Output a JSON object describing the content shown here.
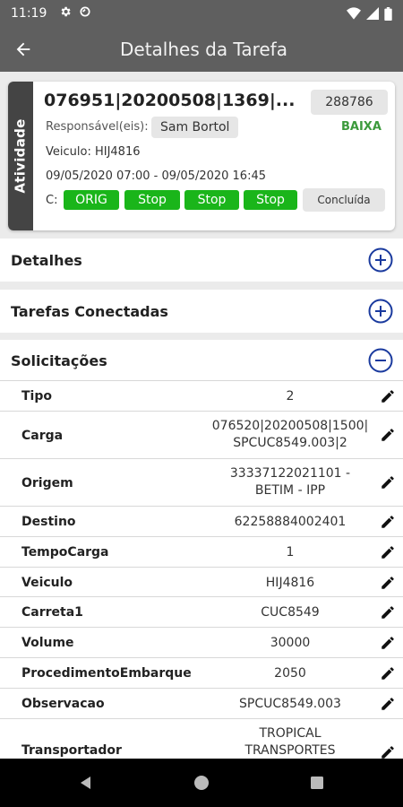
{
  "status_bar": {
    "time": "11:19",
    "icons": [
      "gear-icon",
      "sync-icon",
      "wifi-icon",
      "signal-icon",
      "battery-icon"
    ]
  },
  "app_bar": {
    "title": "Detalhes da Tarefa",
    "back_icon": "arrow-left-icon"
  },
  "card": {
    "side_label": "Atividade",
    "code": "076951|20200508|1369|...",
    "number": "288786",
    "responsible_label": "Responsável(eis):",
    "responsible_name": "Sam Bortol",
    "priority": "BAIXA",
    "vehicle": "Veiculo: HIJ4816",
    "period": "09/05/2020 07:00 - 09/05/2020 16:45",
    "c_label": "C:",
    "steps": [
      "ORIG",
      "Stop",
      "Stop",
      "Stop"
    ],
    "status_button": "Concluída"
  },
  "sections": {
    "detalhes": "Detalhes",
    "tarefas_conectadas": "Tarefas Conectadas",
    "solicitacoes": "Solicitações"
  },
  "rows": [
    {
      "key": "Tipo",
      "value": "2"
    },
    {
      "key": "Carga",
      "value": "076520|20200508|1500|",
      "value2": "SPCUC8549.003|2"
    },
    {
      "key": "Origem",
      "value": "33337122021101 -",
      "value2": "BETIM - IPP"
    },
    {
      "key": "Destino",
      "value": "62258884002401"
    },
    {
      "key": "TempoCarga",
      "value": "1"
    },
    {
      "key": "Veiculo",
      "value": "HIJ4816"
    },
    {
      "key": "Carreta1",
      "value": "CUC8549"
    },
    {
      "key": "Volume",
      "value": "30000"
    },
    {
      "key": "ProcedimentoEmbarque",
      "value": "2050"
    },
    {
      "key": "Observacao",
      "value": "SPCUC8549.003"
    },
    {
      "key": "Transportador",
      "value": "TROPICAL",
      "value2": "TRANSPORTES"
    }
  ],
  "colors": {
    "app_bar": "#5f5f5f",
    "green": "#1ab51a",
    "priority": "#3c9a3c",
    "accent_blue": "#1a3a9e"
  }
}
